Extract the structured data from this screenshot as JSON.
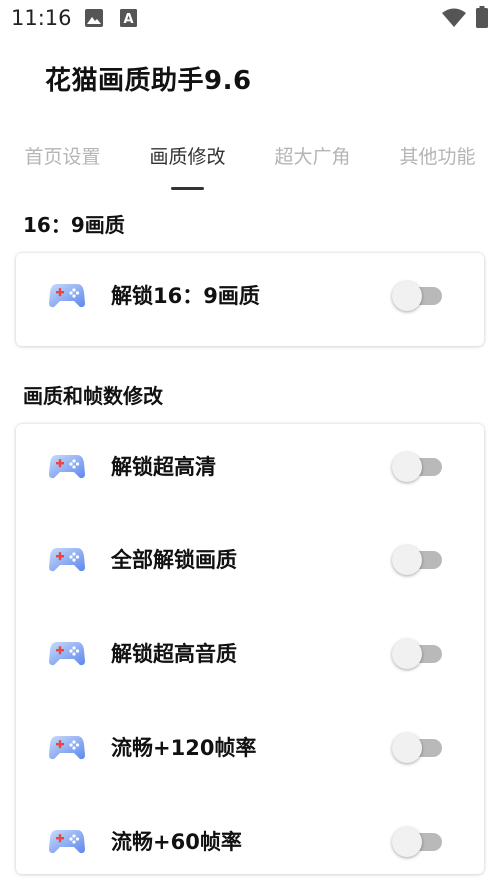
{
  "status_bar": {
    "time": "11:16",
    "left_icons": [
      "image-icon",
      "text-a-icon"
    ],
    "right_icons": [
      "wifi-icon",
      "battery-icon"
    ]
  },
  "app": {
    "title": "花猫画质助手9.6"
  },
  "tabs": [
    {
      "label": "首页设置",
      "active": false
    },
    {
      "label": "画质修改",
      "active": true
    },
    {
      "label": "超大广角",
      "active": false
    },
    {
      "label": "其他功能",
      "active": false
    }
  ],
  "sections": [
    {
      "title": "16：9画质",
      "items": [
        {
          "label": "解锁16：9画质",
          "enabled": false,
          "icon": "gamepad-icon"
        }
      ]
    },
    {
      "title": "画质和帧数修改",
      "items": [
        {
          "label": "解锁超高清",
          "enabled": false,
          "icon": "gamepad-icon"
        },
        {
          "label": "全部解锁画质",
          "enabled": false,
          "icon": "gamepad-icon"
        },
        {
          "label": "解锁超高音质",
          "enabled": false,
          "icon": "gamepad-icon"
        },
        {
          "label": "流畅+120帧率",
          "enabled": false,
          "icon": "gamepad-icon"
        },
        {
          "label": "流畅+60帧率",
          "enabled": false,
          "icon": "gamepad-icon"
        }
      ]
    }
  ],
  "colors": {
    "icon_gradient_start": "#bcd3f9",
    "icon_gradient_end": "#5d87ec",
    "switch_track_off": "#b9b9b9",
    "switch_thumb_off": "#f1f1f1"
  }
}
